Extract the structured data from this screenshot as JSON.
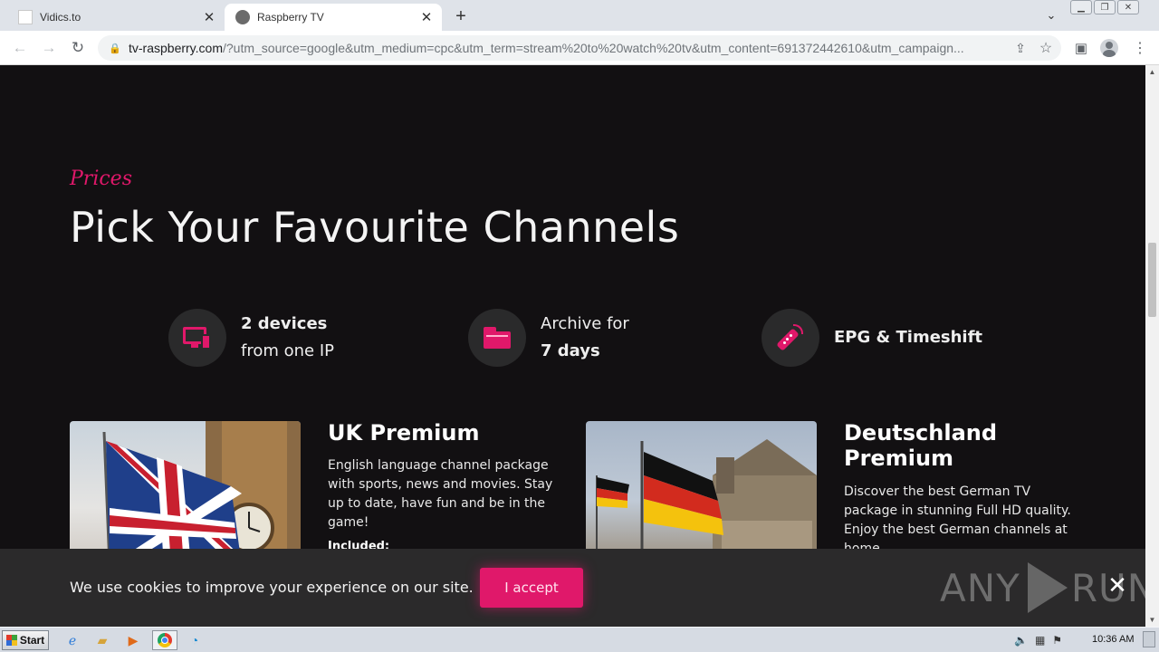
{
  "browser": {
    "tabs": [
      {
        "title": "Vidics.to",
        "active": false
      },
      {
        "title": "Raspberry TV",
        "active": true
      }
    ],
    "url_host": "tv-raspberry.com",
    "url_rest": "/?utm_source=google&utm_medium=cpc&utm_term=stream%20to%20watch%20tv&utm_content=691372442610&utm_campaign..."
  },
  "page": {
    "eyebrow": "Prices",
    "headline": "Pick Your Favourite Channels",
    "features": [
      {
        "icon": "devices-icon",
        "bold_line": "2 devices",
        "line": "from one IP"
      },
      {
        "icon": "folder-icon",
        "line": "Archive for",
        "bold_line": "7 days"
      },
      {
        "icon": "remote-icon",
        "bold_line": "EPG & Timeshift"
      }
    ],
    "packages": [
      {
        "title": "UK Premium",
        "description": "English language channel package with sports, news and movies. Stay up to date, have fun and be in the game!",
        "included_label": "Included:"
      },
      {
        "title": "Deutschland Premium",
        "description": "Discover the best German TV package in stunning Full HD quality. Enjoy the best German channels at home."
      }
    ],
    "accent_color": "#e0186a"
  },
  "cookie": {
    "text": "We use cookies to improve your experience on our site.",
    "accept_label": "I accept",
    "close_icon": "close-icon"
  },
  "watermark": {
    "left": "ANY",
    "right": "RUN"
  },
  "taskbar": {
    "start_label": "Start",
    "clock": "10:36 AM"
  }
}
